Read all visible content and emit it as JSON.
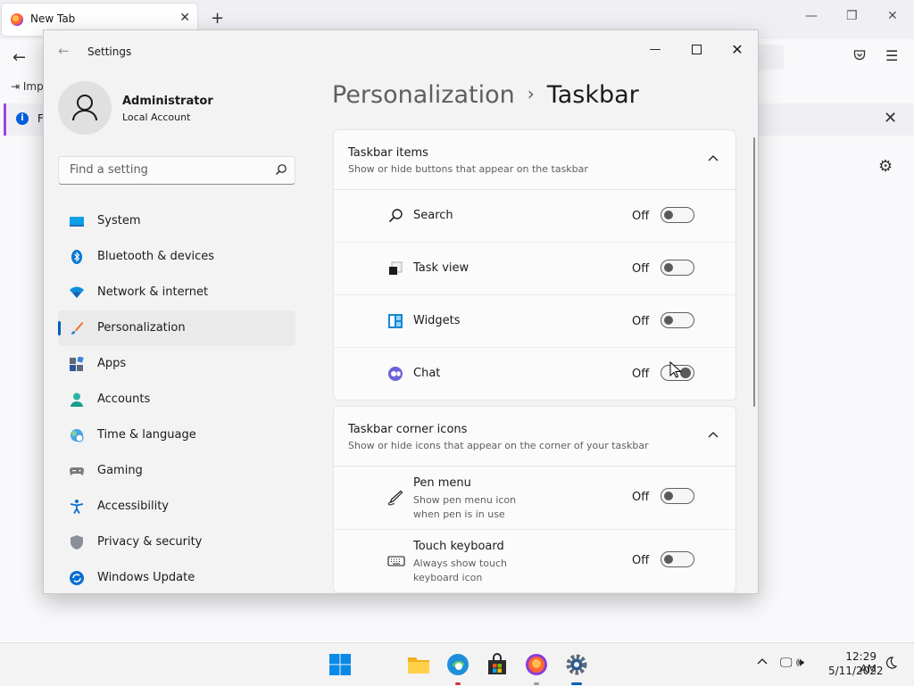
{
  "browser": {
    "tab_title": "New Tab",
    "bookmark_text": "Imp",
    "notice_text": "F"
  },
  "settings": {
    "window_title": "Settings",
    "profile": {
      "name": "Administrator",
      "account_type": "Local Account"
    },
    "search_placeholder": "Find a setting",
    "nav": [
      {
        "label": "System",
        "icon": "monitor-icon"
      },
      {
        "label": "Bluetooth & devices",
        "icon": "bluetooth-icon"
      },
      {
        "label": "Network & internet",
        "icon": "wifi-icon"
      },
      {
        "label": "Personalization",
        "icon": "paintbrush-icon",
        "active": true
      },
      {
        "label": "Apps",
        "icon": "apps-icon"
      },
      {
        "label": "Accounts",
        "icon": "person-icon"
      },
      {
        "label": "Time & language",
        "icon": "globe-clock-icon"
      },
      {
        "label": "Gaming",
        "icon": "gamepad-icon"
      },
      {
        "label": "Accessibility",
        "icon": "accessibility-icon"
      },
      {
        "label": "Privacy & security",
        "icon": "shield-icon"
      },
      {
        "label": "Windows Update",
        "icon": "update-icon"
      }
    ],
    "breadcrumb": {
      "parent": "Personalization",
      "separator": "›",
      "current": "Taskbar"
    },
    "taskbar_items": {
      "title": "Taskbar items",
      "description": "Show or hide buttons that appear on the taskbar",
      "rows": [
        {
          "label": "Search",
          "state": "Off",
          "icon": "search-icon"
        },
        {
          "label": "Task view",
          "state": "Off",
          "icon": "task-view-icon"
        },
        {
          "label": "Widgets",
          "state": "Off",
          "icon": "widgets-icon"
        },
        {
          "label": "Chat",
          "state": "Off",
          "icon": "chat-icon"
        }
      ]
    },
    "corner_icons": {
      "title": "Taskbar corner icons",
      "description": "Show or hide icons that appear on the corner of your taskbar",
      "rows": [
        {
          "label": "Pen menu",
          "description": "Show pen menu icon when pen is in use",
          "state": "Off",
          "icon": "pen-icon"
        },
        {
          "label": "Touch keyboard",
          "description": "Always show touch keyboard icon",
          "state": "Off",
          "icon": "keyboard-icon"
        }
      ]
    }
  },
  "taskbar": {
    "time": "12:29 AM",
    "date": "5/11/2022"
  },
  "colors": {
    "accent": "#005fb8",
    "window_bg": "#f3f3f3",
    "card_bg": "#fbfbfb"
  }
}
